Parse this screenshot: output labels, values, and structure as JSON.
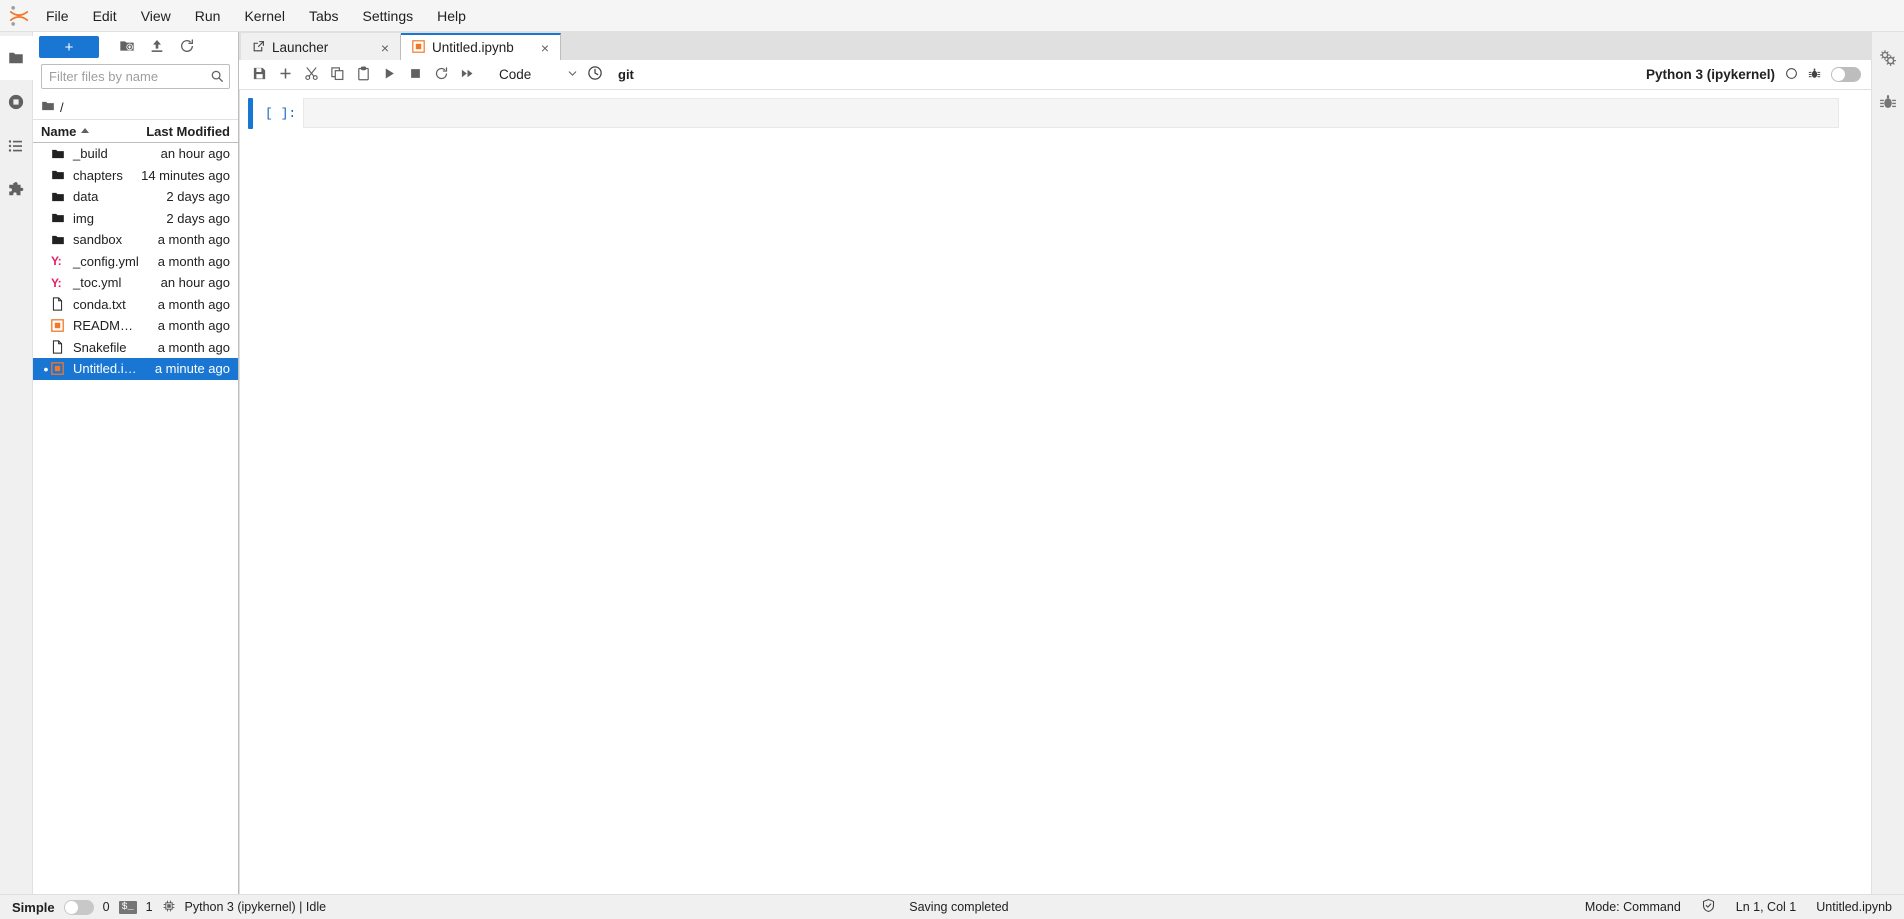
{
  "menubar": {
    "logo": "jupyter-logo",
    "items": [
      {
        "label": "File"
      },
      {
        "label": "Edit"
      },
      {
        "label": "View"
      },
      {
        "label": "Run"
      },
      {
        "label": "Kernel"
      },
      {
        "label": "Tabs"
      },
      {
        "label": "Settings"
      },
      {
        "label": "Help"
      }
    ]
  },
  "left_sidebar": {
    "items": [
      {
        "name": "file-browser",
        "icon": "folder-icon",
        "active": true
      },
      {
        "name": "running-sessions",
        "icon": "running-circle-icon",
        "active": false
      },
      {
        "name": "table-of-contents",
        "icon": "list-icon",
        "active": false
      },
      {
        "name": "extension-manager",
        "icon": "puzzle-icon",
        "active": false
      }
    ]
  },
  "right_sidebar": {
    "items": [
      {
        "name": "property-inspector",
        "icon": "gears-icon"
      },
      {
        "name": "debugger",
        "icon": "bug-icon"
      }
    ]
  },
  "filebrowser": {
    "new_launcher_label": "+",
    "toolbar": [
      {
        "name": "new-folder",
        "icon": "new-folder-icon"
      },
      {
        "name": "upload",
        "icon": "upload-icon"
      },
      {
        "name": "refresh",
        "icon": "refresh-icon"
      }
    ],
    "filter": {
      "placeholder": "Filter files by name",
      "value": ""
    },
    "breadcrumb": "/",
    "columns": {
      "name": "Name",
      "last_modified": "Last Modified"
    },
    "sort": "ascending",
    "rows": [
      {
        "name": "_build",
        "modified": "an hour ago",
        "icon": "folder-icon",
        "type": "folder",
        "selected": false,
        "dirty": false
      },
      {
        "name": "chapters",
        "modified": "14 minutes ago",
        "icon": "folder-icon",
        "type": "folder",
        "selected": false,
        "dirty": false
      },
      {
        "name": "data",
        "modified": "2 days ago",
        "icon": "folder-icon",
        "type": "folder",
        "selected": false,
        "dirty": false
      },
      {
        "name": "img",
        "modified": "2 days ago",
        "icon": "folder-icon",
        "type": "folder",
        "selected": false,
        "dirty": false
      },
      {
        "name": "sandbox",
        "modified": "a month ago",
        "icon": "folder-icon",
        "type": "folder",
        "selected": false,
        "dirty": false
      },
      {
        "name": "_config.yml",
        "modified": "a month ago",
        "icon": "yaml-icon",
        "type": "yaml",
        "selected": false,
        "dirty": false
      },
      {
        "name": "_toc.yml",
        "modified": "an hour ago",
        "icon": "yaml-icon",
        "type": "yaml",
        "selected": false,
        "dirty": false
      },
      {
        "name": "conda.txt",
        "modified": "a month ago",
        "icon": "text-file-icon",
        "type": "text",
        "selected": false,
        "dirty": false
      },
      {
        "name": "README....",
        "modified": "a month ago",
        "icon": "notebook-icon",
        "type": "notebook",
        "selected": false,
        "dirty": false
      },
      {
        "name": "Snakefile",
        "modified": "a month ago",
        "icon": "text-file-icon",
        "type": "text",
        "selected": false,
        "dirty": false
      },
      {
        "name": "Untitled.ip...",
        "modified": "a minute ago",
        "icon": "notebook-icon",
        "type": "notebook",
        "selected": true,
        "dirty": true
      }
    ]
  },
  "tabs": [
    {
      "label": "Launcher",
      "icon": "launcher-icon",
      "active": false,
      "close": "×"
    },
    {
      "label": "Untitled.ipynb",
      "icon": "notebook-icon",
      "active": true,
      "close": "×"
    }
  ],
  "notebook_toolbar": {
    "buttons": [
      {
        "name": "save-button",
        "icon": "save-icon"
      },
      {
        "name": "insert-cell-button",
        "icon": "plus-icon"
      },
      {
        "name": "cut-cell-button",
        "icon": "scissors-icon"
      },
      {
        "name": "copy-cell-button",
        "icon": "copy-icon"
      },
      {
        "name": "paste-cell-button",
        "icon": "paste-icon"
      },
      {
        "name": "run-cell-button",
        "icon": "play-icon"
      },
      {
        "name": "interrupt-kernel-button",
        "icon": "stop-icon"
      },
      {
        "name": "restart-kernel-button",
        "icon": "restart-icon"
      },
      {
        "name": "restart-run-all-button",
        "icon": "fast-forward-icon"
      }
    ],
    "cell_type": "Code",
    "history_icon": "clock-icon",
    "git_label": "git"
  },
  "kernel": {
    "name": "Python 3 (ipykernel)",
    "status_icon": "idle-circle-icon",
    "debug_icon": "bug-icon",
    "toggle_state": "off"
  },
  "notebook": {
    "cells": [
      {
        "prompt": "[ ]:",
        "source": "",
        "selected": true
      }
    ]
  },
  "statusbar": {
    "simple_label": "Simple",
    "simple_toggle": "off",
    "kernel_count": "0",
    "terminal_icon": "terminal-icon",
    "terminal_count": "1",
    "cpu_icon": "cpu-icon",
    "kernel_text": "Python 3 (ipykernel) | Idle",
    "message": "Saving completed",
    "mode": "Mode: Command",
    "trust_icon": "trusted-shield-icon",
    "cursor": "Ln 1, Col 1",
    "filename": "Untitled.ipynb"
  },
  "colors": {
    "accent": "#1976d2",
    "selection": "#1976d2",
    "yaml": "#e91e63",
    "notebook": "#f37726",
    "statusbar_bg": "#f0f0f0"
  }
}
